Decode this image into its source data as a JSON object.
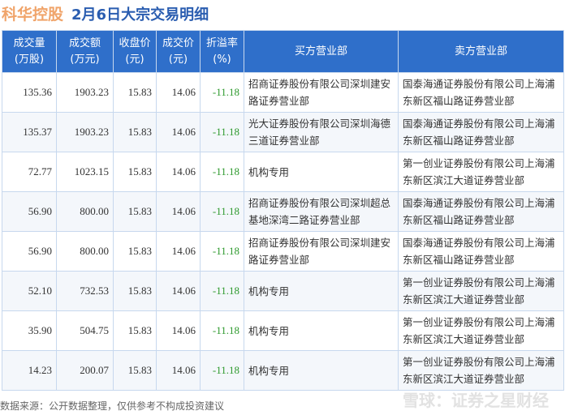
{
  "title": {
    "name": "科华控股",
    "subtitle": "2月6日大宗交易明细"
  },
  "headers": [
    "成交量(万股)",
    "成交额(万元)",
    "收盘价(元)",
    "成交价(元)",
    "折溢率(%)",
    "买方营业部",
    "卖方营业部"
  ],
  "header_lines": [
    [
      "成交量",
      "(万股)"
    ],
    [
      "成交额",
      "(万元)"
    ],
    [
      "收盘价",
      "(元)"
    ],
    [
      "成交价",
      "(元)"
    ],
    [
      "折溢率",
      "(%)"
    ],
    [
      "买方营业部"
    ],
    [
      "卖方营业部"
    ]
  ],
  "rows": [
    [
      "135.36",
      "1903.23",
      "15.83",
      "14.06",
      "-11.18",
      "招商证券股份有限公司深圳建安路证券营业部",
      "国泰海通证券股份有限公司上海浦东新区福山路证券营业部"
    ],
    [
      "135.37",
      "1903.23",
      "15.83",
      "14.06",
      "-11.18",
      "光大证券股份有限公司深圳海德三道证券营业部",
      "国泰海通证券股份有限公司上海浦东新区福山路证券营业部"
    ],
    [
      "72.77",
      "1023.15",
      "15.83",
      "14.06",
      "-11.18",
      "机构专用",
      "第一创业证券股份有限公司上海浦东新区滨江大道证券营业部"
    ],
    [
      "56.90",
      "800.00",
      "15.83",
      "14.06",
      "-11.18",
      "招商证券股份有限公司深圳超总基地深湾二路证券营业部",
      "国泰海通证券股份有限公司上海浦东新区福山路证券营业部"
    ],
    [
      "56.90",
      "800.00",
      "15.83",
      "14.06",
      "-11.18",
      "招商证券股份有限公司深圳建安路证券营业部",
      "国泰海通证券股份有限公司上海浦东新区福山路证券营业部"
    ],
    [
      "52.10",
      "732.53",
      "15.83",
      "14.06",
      "-11.18",
      "机构专用",
      "第一创业证券股份有限公司上海浦东新区滨江大道证券营业部"
    ],
    [
      "35.90",
      "504.75",
      "15.83",
      "14.06",
      "-11.18",
      "机构专用",
      "第一创业证券股份有限公司上海浦东新区滨江大道证券营业部"
    ],
    [
      "14.23",
      "200.07",
      "15.83",
      "14.06",
      "-11.18",
      "机构专用",
      "第一创业证券股份有限公司上海浦东新区滨江大道证券营业部"
    ]
  ],
  "source": "数据来源：公开数据整理，仅供参考不构成投资建议",
  "watermark": "雪球：证券之星财经"
}
